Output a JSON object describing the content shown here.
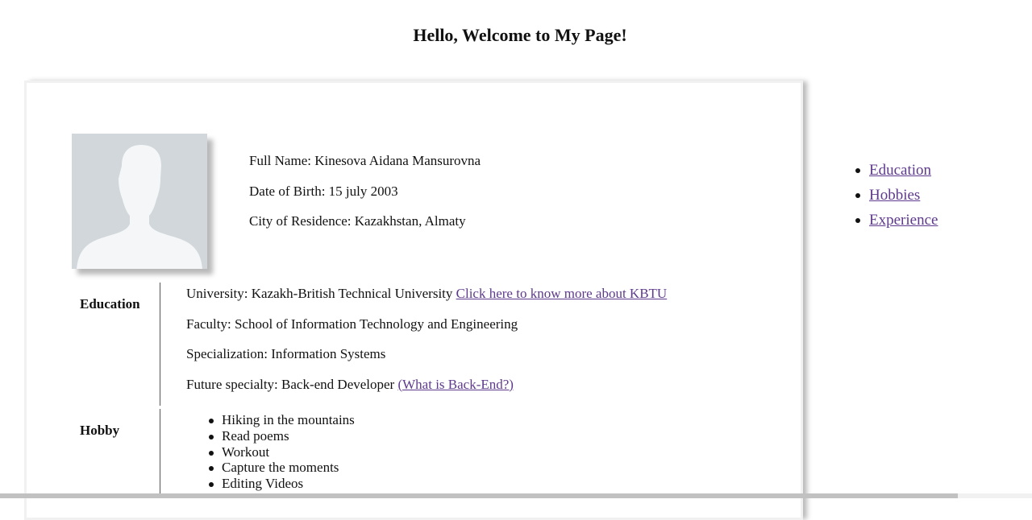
{
  "header": {
    "title": "Hello, Welcome to My Page!"
  },
  "profile": {
    "avatar_icon": "default-person-silhouette",
    "full_name": "Full Name: Kinesova Aidana Mansurovna",
    "date_of_birth": "Date of Birth: 15 july 2003",
    "city": "City of Residence: Kazakhstan, Almaty"
  },
  "education": {
    "label": "Education",
    "university_text": "University: Kazakh-British Technical University ",
    "university_link": "Click here to know more about KBTU",
    "faculty": "Faculty: School of Information Technology and Engineering",
    "specialization": "Specialization: Information Systems",
    "future_text": "Future specialty: Back-end Developer ",
    "future_link": "(What is Back-End?)"
  },
  "hobby": {
    "label": "Hobby",
    "items": [
      "Hiking in the mountains",
      "Read poems",
      "Workout",
      "Capture the moments",
      "Editing Videos"
    ]
  },
  "nav": {
    "items": [
      {
        "label": "Education"
      },
      {
        "label": "Hobbies"
      },
      {
        "label": "Experience"
      }
    ]
  },
  "colors": {
    "link": "#5e3a8c",
    "avatar_bg": "#d1d7da",
    "avatar_figure": "#f4f6f7"
  }
}
